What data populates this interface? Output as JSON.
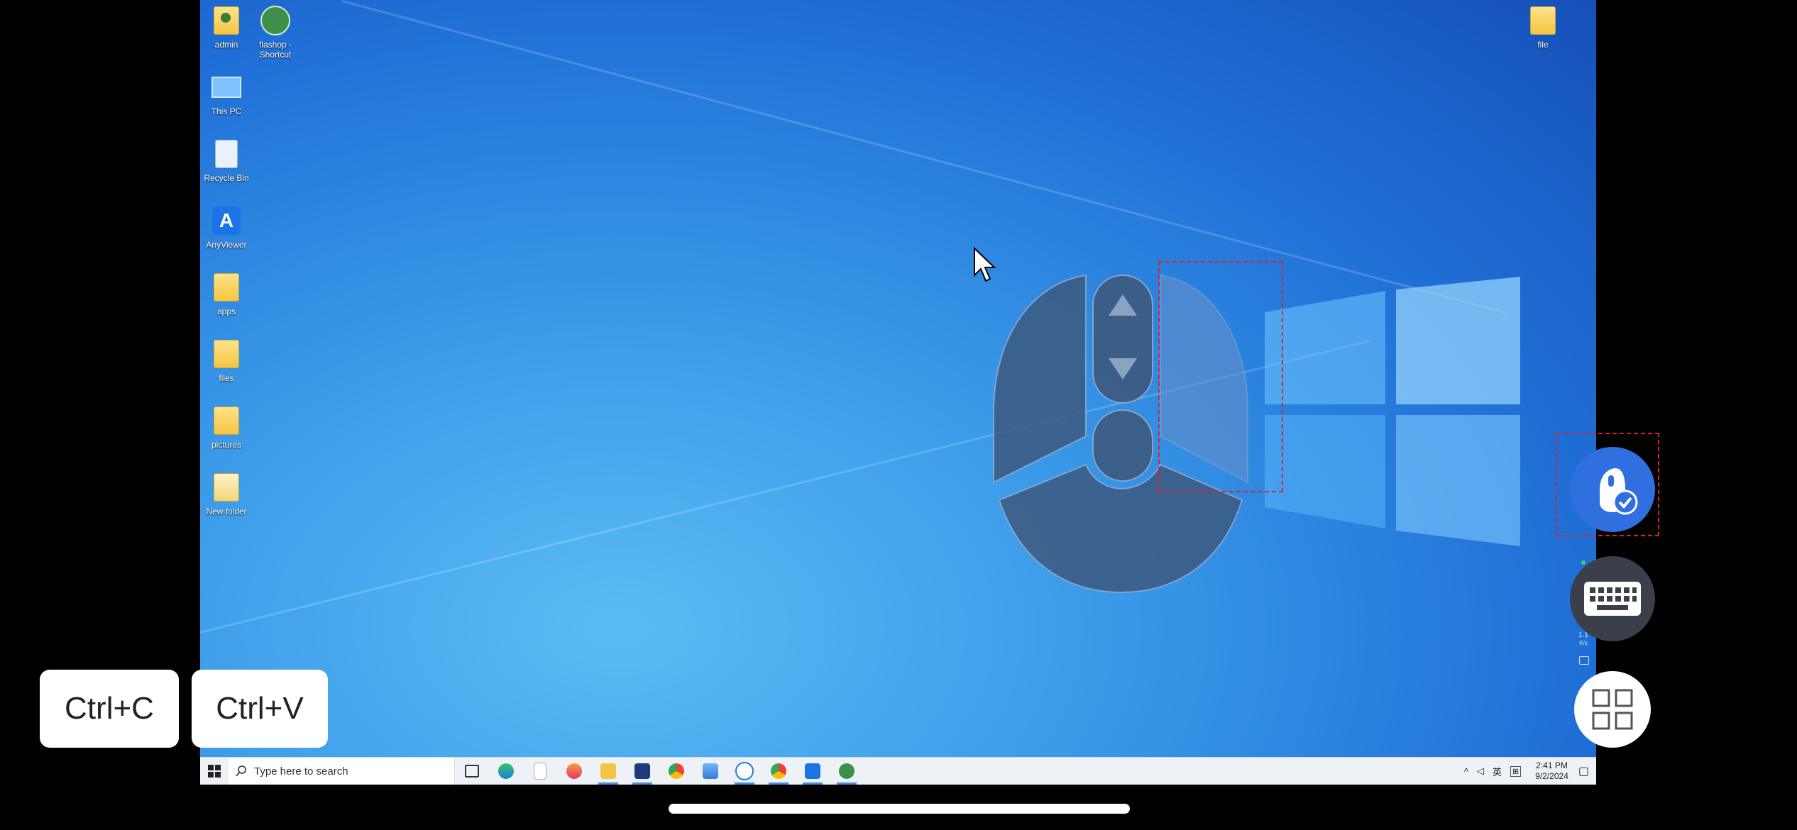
{
  "desktop": {
    "icons_left": [
      {
        "label": "admin",
        "icon": "user-folder-icon"
      },
      {
        "label": "flashop - Shortcut",
        "icon": "shortcut-app-icon"
      },
      {
        "label": "This PC",
        "icon": "this-pc-icon"
      },
      {
        "label": "Recycle Bin",
        "icon": "recycle-bin-icon"
      },
      {
        "label": "AnyViewer",
        "icon": "anyviewer-icon"
      },
      {
        "label": "apps",
        "icon": "folder-icon"
      },
      {
        "label": "files",
        "icon": "folder-icon"
      },
      {
        "label": "pictures",
        "icon": "folder-icon"
      },
      {
        "label": "New folder",
        "icon": "folder-icon"
      }
    ],
    "icon_right": {
      "label": "file",
      "icon": "folder-icon"
    }
  },
  "taskbar": {
    "search_placeholder": "Type here to search",
    "apps": [
      "task-view-icon",
      "edge-icon",
      "notepad-icon",
      "firefox-icon",
      "file-explorer-icon",
      "app-icon",
      "chrome-icon",
      "photos-icon",
      "chat-icon",
      "chrome-alt-icon",
      "anyviewer-icon",
      "flashop-icon"
    ],
    "tray": {
      "ime": "英",
      "time": "2:41 PM",
      "date": "9/2/2024"
    }
  },
  "overlay": {
    "copy_label": "Ctrl+C",
    "paste_label": "Ctrl+V",
    "mouse_button": "mouse-mode-icon",
    "keyboard_button": "keyboard-icon",
    "menu_button": "grid-menu-icon",
    "speed_label": "1.1",
    "speed_unit": "K/s"
  },
  "colors": {
    "desktop_blue": "#1f6fd6",
    "fab_blue": "#2f6fe0",
    "fab_dark": "#3a3f4a",
    "dash_red": "#e0202a"
  }
}
